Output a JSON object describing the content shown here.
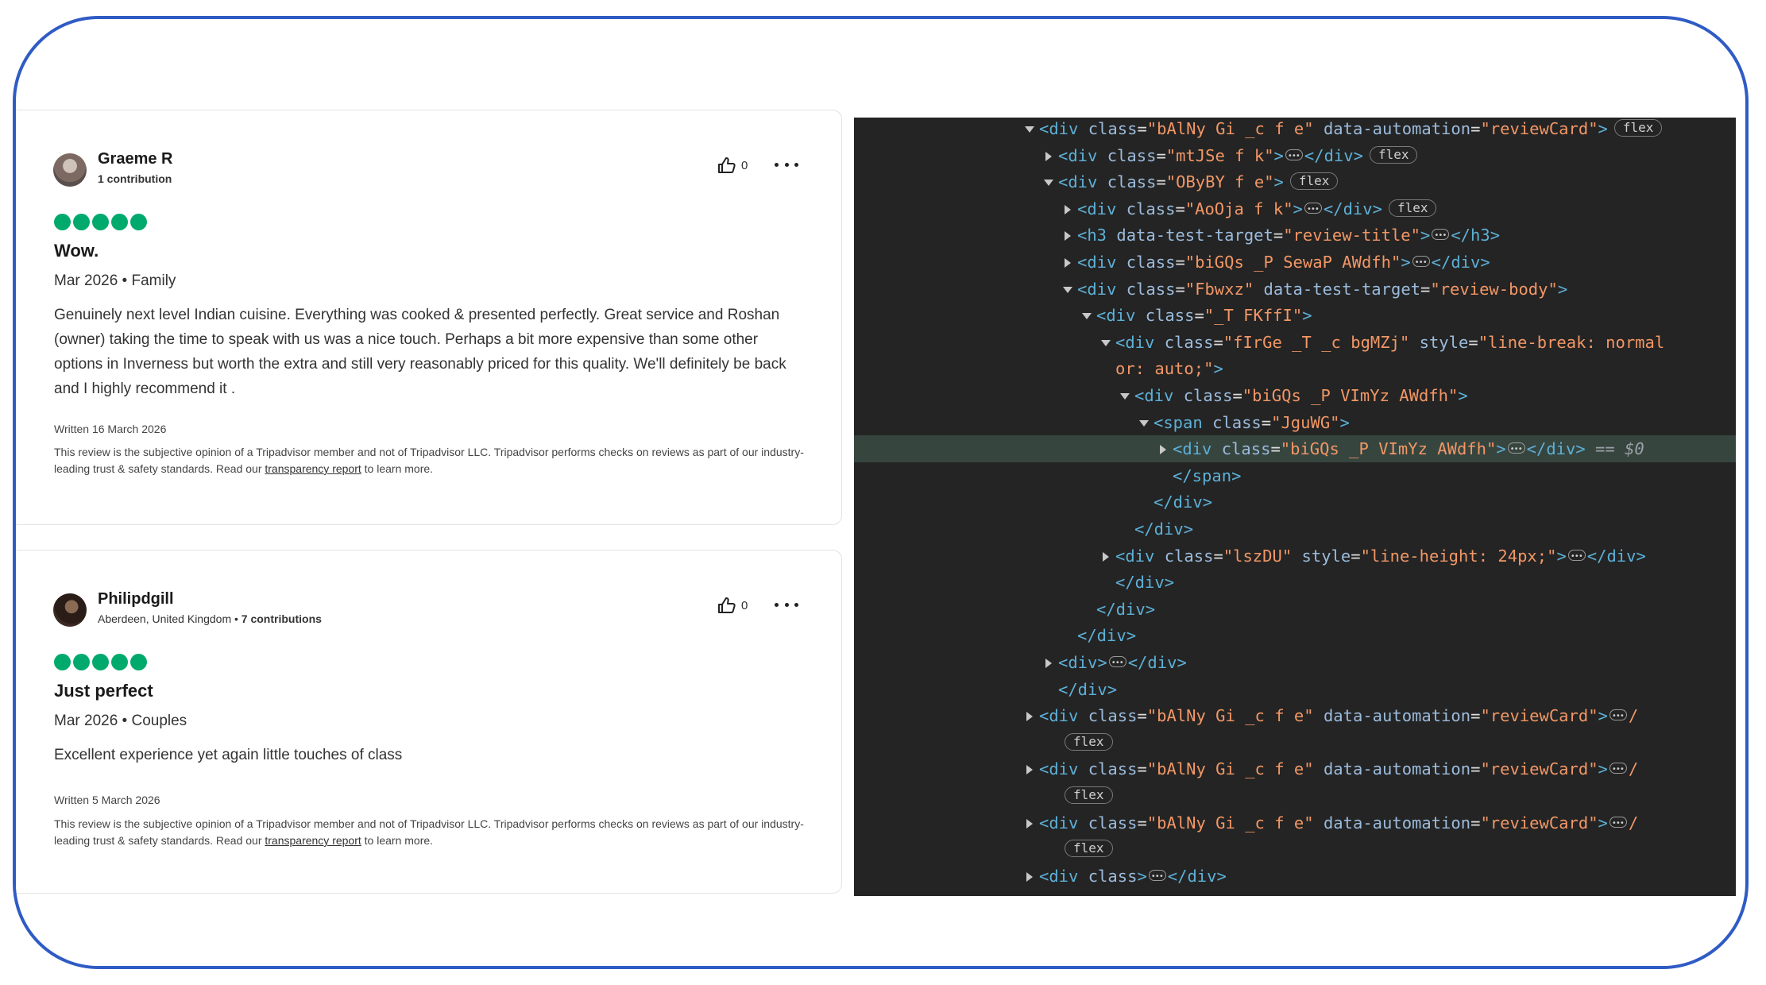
{
  "reviews": [
    {
      "user": "Graeme R",
      "location": "",
      "contributions": "1 contribution",
      "helpful_count": "0",
      "title": "Wow.",
      "date_trip": "Mar 2026 • Family",
      "body": "Genuinely next level Indian cuisine. Everything was cooked & presented perfectly. Great service and Roshan (owner) taking the time to speak with us was a nice touch. Perhaps a bit more expensive than some other options in Inverness but worth the extra and still very reasonably priced for this quality. We'll definitely be back and I highly recommend it .",
      "written": "Written 16 March 2026",
      "rating": 5
    },
    {
      "user": "Philipdgill",
      "location": "Aberdeen, United Kingdom • ",
      "contributions": "7 contributions",
      "helpful_count": "0",
      "title": "Just perfect",
      "date_trip": "Mar 2026 • Couples",
      "body": "Excellent experience yet again little touches of class",
      "written": "Written 5 March 2026",
      "rating": 5
    }
  ],
  "disclaimer": {
    "text_before": "This review is the subjective opinion of a Tripadvisor member and not of Tripadvisor LLC. Tripadvisor performs checks on reviews as part of our industry-leading trust & safety standards. Read our ",
    "link": "transparency report",
    "text_after": " to learn more."
  },
  "devtools": {
    "lines": [
      {
        "indent": 0,
        "arrow": "down",
        "html": "<div class=\"bAlNy Gi _c f e\" data-automation=\"reviewCard\">",
        "badge": "flex"
      },
      {
        "indent": 1,
        "arrow": "right",
        "html": "<div class=\"mtJSe f k\">",
        "ellipsis": true,
        "close": "</div>",
        "badge": "flex"
      },
      {
        "indent": 1,
        "arrow": "down",
        "html": "<div class=\"OByBY f e\">",
        "badge": "flex"
      },
      {
        "indent": 2,
        "arrow": "right",
        "html": "<div class=\"AoOja f k\">",
        "ellipsis": true,
        "close": "</div>",
        "badge": "flex"
      },
      {
        "indent": 2,
        "arrow": "right",
        "html": "<h3 data-test-target=\"review-title\">",
        "ellipsis": true,
        "close": "</h3>"
      },
      {
        "indent": 2,
        "arrow": "right",
        "html": "<div class=\"biGQs _P SewaP AWdfh\">",
        "ellipsis": true,
        "close": "</div>"
      },
      {
        "indent": 2,
        "arrow": "down",
        "html": "<div class=\"Fbwxz\" data-test-target=\"review-body\">"
      },
      {
        "indent": 3,
        "arrow": "down",
        "html": "<div class=\"_T FKffI\">"
      },
      {
        "indent": 4,
        "arrow": "down",
        "html": "<div class=\"fIrGe _T _c bgMZj\" style=\"line-break: normal"
      },
      {
        "indent": 4,
        "arrow": "none",
        "html": "or: auto;\">"
      },
      {
        "indent": 5,
        "arrow": "down",
        "html": "<div class=\"biGQs _P VImYz AWdfh\">"
      },
      {
        "indent": 6,
        "arrow": "down",
        "html": "<span class=\"JguWG\">"
      },
      {
        "indent": 7,
        "arrow": "right",
        "html": "<div class=\"biGQs _P VImYz AWdfh\">",
        "ellipsis": true,
        "close": "</div>",
        "suffix": " == $0",
        "selected": true
      },
      {
        "indent": 7,
        "arrow": "none",
        "html": "</span>"
      },
      {
        "indent": 6,
        "arrow": "none",
        "html": "</div>"
      },
      {
        "indent": 5,
        "arrow": "none",
        "html": "</div>"
      },
      {
        "indent": 4,
        "arrow": "right",
        "html": "<div class=\"lszDU\" style=\"line-height: 24px;\">",
        "ellipsis": true,
        "close": "</div>"
      },
      {
        "indent": 4,
        "arrow": "none",
        "html": "</div>"
      },
      {
        "indent": 3,
        "arrow": "none",
        "html": "</div>"
      },
      {
        "indent": 2,
        "arrow": "none",
        "html": "</div>"
      },
      {
        "indent": 1,
        "arrow": "right",
        "html": "<div>",
        "ellipsis": true,
        "close": "</div>"
      },
      {
        "indent": 1,
        "arrow": "none",
        "html": "</div>"
      },
      {
        "indent": 0,
        "arrow": "right",
        "html": "<div class=\"bAlNy Gi _c f e\" data-automation=\"reviewCard\">",
        "ellipsis": true,
        "close": "</"
      },
      {
        "indent": 1,
        "arrow": "none",
        "html": "",
        "badge": "flex"
      },
      {
        "indent": 0,
        "arrow": "right",
        "html": "<div class=\"bAlNy Gi _c f e\" data-automation=\"reviewCard\">",
        "ellipsis": true,
        "close": "</"
      },
      {
        "indent": 1,
        "arrow": "none",
        "html": "",
        "badge": "flex"
      },
      {
        "indent": 0,
        "arrow": "right",
        "html": "<div class=\"bAlNy Gi _c f e\" data-automation=\"reviewCard\">",
        "ellipsis": true,
        "close": "</"
      },
      {
        "indent": 1,
        "arrow": "none",
        "html": "",
        "badge": "flex"
      },
      {
        "indent": 0,
        "arrow": "right",
        "html": "<div class>",
        "ellipsis": true,
        "close": "</div>"
      }
    ]
  },
  "colors": {
    "frame_border": "#2f5bc4",
    "rating_bubble": "#00aa6c",
    "devtools_bg": "#242424",
    "selected_row": "#37453f"
  }
}
